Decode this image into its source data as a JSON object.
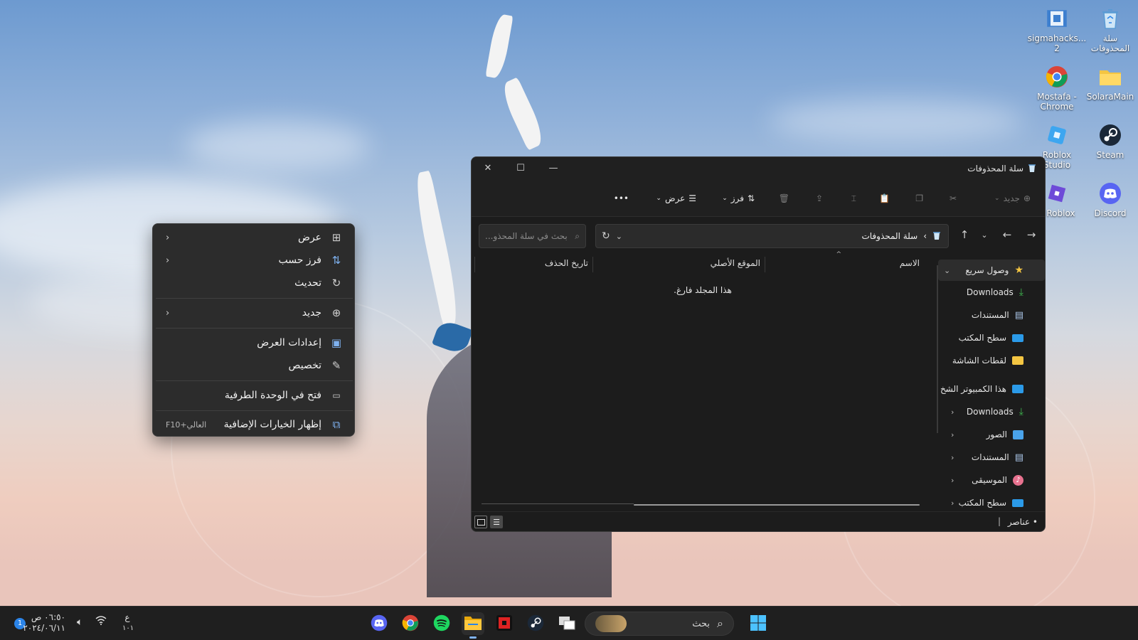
{
  "desktop": {
    "icons": [
      {
        "label": "سلة المحذوفات",
        "icon": "recycle-bin-icon"
      },
      {
        "label": "sigmahacks... 2",
        "icon": "video-file-icon"
      },
      {
        "label": "SolaraMain",
        "icon": "folder-icon"
      },
      {
        "label": "Mostafa - Chrome",
        "icon": "chrome-icon"
      },
      {
        "label": "Steam",
        "icon": "steam-icon"
      },
      {
        "label": "Roblox Studio",
        "icon": "roblox-studio-icon"
      },
      {
        "label": "Discord",
        "icon": "discord-icon"
      },
      {
        "label": "y Roblox",
        "icon": "roblox-icon"
      }
    ]
  },
  "context_menu": {
    "items": [
      {
        "label": "عرض",
        "icon": "grid-icon",
        "submenu": true
      },
      {
        "label": "فرز حسب",
        "icon": "sort-icon",
        "submenu": true
      },
      {
        "label": "تحديث",
        "icon": "refresh-icon"
      },
      {
        "label": "جديد",
        "icon": "plus-circle-icon",
        "submenu": true
      },
      {
        "label": "إعدادات العرض",
        "icon": "display-settings-icon"
      },
      {
        "label": "تخصيص",
        "icon": "brush-icon"
      },
      {
        "label": "فتح في الوحدة الطرفية",
        "icon": "terminal-icon"
      },
      {
        "label": "إظهار الخيارات الإضافية",
        "icon": "more-options-icon",
        "shortcut": "العالي+F10"
      }
    ]
  },
  "explorer": {
    "title": "سلة المحذوفات",
    "toolbar": {
      "new_label": "جديد",
      "sort_label": "فرز",
      "view_label": "عرض",
      "more_label": "•••"
    },
    "address": {
      "path": "سلة المحذوفات",
      "search_placeholder": "بحث في سلة المحذو..."
    },
    "columns": [
      "الاسم",
      "الموقع الأصلي",
      "تاريخ الحذف"
    ],
    "empty_message": "هذا المجلد فارغ.",
    "nav": {
      "quick_access": "وصول سريع",
      "quick_items": [
        "Downloads",
        "المستندات",
        "سطح المكتب",
        "لقطات الشاشة"
      ],
      "this_pc": "هذا الكمبيوتر الشخ",
      "pc_items": [
        "Downloads",
        "الصور",
        "المستندات",
        "الموسيقى",
        "سطح المكتب"
      ]
    },
    "status": {
      "items_text": "• عناصر",
      "separator": "|"
    }
  },
  "taskbar": {
    "search_label": "بحث",
    "apps": [
      "discord-icon",
      "chrome-icon",
      "spotify-icon",
      "file-explorer-icon",
      "roblox-icon",
      "steam-icon",
      "task-view-icon"
    ],
    "clock": {
      "time": "٠٦:٥٠ ص",
      "date": "٢٠٢٤/٠٦/١١"
    },
    "language": {
      "line1": "ع",
      "line2": "١٠١"
    },
    "notification_count": "1"
  },
  "colors": {
    "explorer_bg": "#1c1c1c",
    "menu_bg": "#2c2c2c",
    "taskbar_bg": "#1f1f1f",
    "accent_download": "#3fb950",
    "accent_folder": "#f4c542",
    "accent_blue": "#2b84e8"
  }
}
